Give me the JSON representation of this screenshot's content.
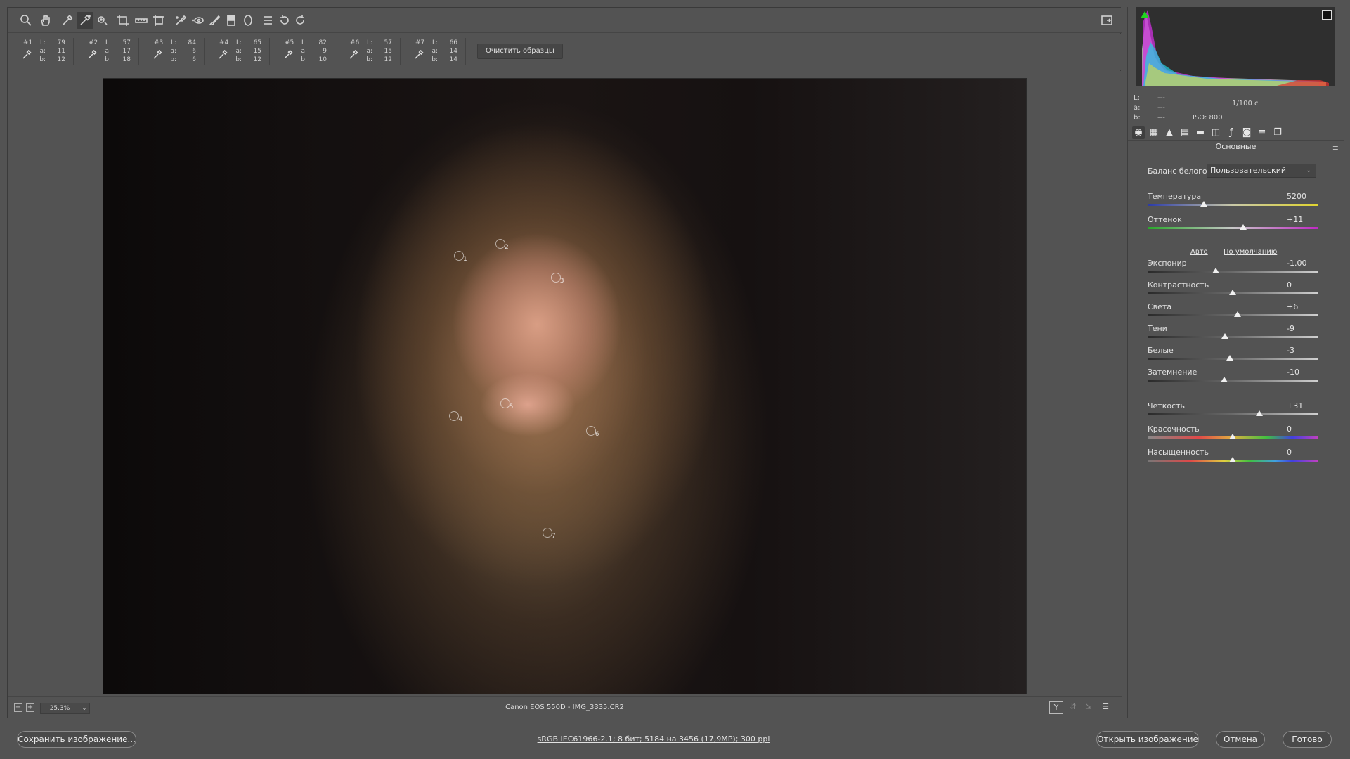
{
  "samplers": [
    {
      "num": "#1",
      "L": "79",
      "a": "11",
      "b": "12"
    },
    {
      "num": "#2",
      "L": "57",
      "a": "17",
      "b": "18"
    },
    {
      "num": "#3",
      "L": "84",
      "a": "6",
      "b": "6"
    },
    {
      "num": "#4",
      "L": "65",
      "a": "15",
      "b": "12"
    },
    {
      "num": "#5",
      "L": "82",
      "a": "9",
      "b": "10"
    },
    {
      "num": "#6",
      "L": "57",
      "a": "15",
      "b": "12"
    },
    {
      "num": "#7",
      "L": "66",
      "a": "14",
      "b": "14"
    }
  ],
  "sampler_labels": {
    "L": "L:",
    "a": "a:",
    "b": "b:"
  },
  "clear_samplers_label": "Очистить образцы",
  "markers": [
    "1",
    "2",
    "3",
    "4",
    "5",
    "6",
    "7"
  ],
  "status": {
    "zoom": "25.3%",
    "filename": "Canon EOS 550D  -  IMG_3335.CR2",
    "view_mode": "Y"
  },
  "readout": {
    "L_label": "L:",
    "a_label": "a:",
    "b_label": "b:",
    "L_value": "---",
    "a_value": "---",
    "b_value": "---",
    "shutter": "1/100 с",
    "iso": "ISO: 800"
  },
  "panel": {
    "title": "Основные",
    "wb_label": "Баланс белого:",
    "wb_value": "Пользовательский",
    "auto_link": "Авто",
    "default_link": "По умолчанию"
  },
  "sliders": [
    {
      "id": "temperature",
      "label": "Температура",
      "value": "5200",
      "pos": 0.33
    },
    {
      "id": "tint",
      "label": "Оттенок",
      "value": "+11",
      "pos": 0.56
    },
    {
      "id": "exposure",
      "label": "Экспонир",
      "value": "-1.00",
      "pos": 0.4
    },
    {
      "id": "contrast",
      "label": "Контрастность",
      "value": "0",
      "pos": 0.5
    },
    {
      "id": "highlights",
      "label": "Света",
      "value": "+6",
      "pos": 0.53
    },
    {
      "id": "shadows",
      "label": "Тени",
      "value": "-9",
      "pos": 0.455
    },
    {
      "id": "whites",
      "label": "Белые",
      "value": "-3",
      "pos": 0.485
    },
    {
      "id": "blacks",
      "label": "Затемнение",
      "value": "-10",
      "pos": 0.45
    },
    {
      "id": "clarity",
      "label": "Четкость",
      "value": "+31",
      "pos": 0.655
    },
    {
      "id": "vibrance",
      "label": "Красочность",
      "value": "0",
      "pos": 0.5
    },
    {
      "id": "saturation",
      "label": "Насыщенность",
      "value": "0",
      "pos": 0.5
    }
  ],
  "footer": {
    "save_label": "Сохранить изображение...",
    "workflow_options": "sRGB IEC61966-2.1; 8 бит; 5184 на 3456 (17,9МР); 300 ppi",
    "open_label": "Открыть изображение",
    "cancel_label": "Отмена",
    "done_label": "Готово"
  },
  "colors": {
    "background": "#535353",
    "clip_shadow": "#1fd41f"
  }
}
